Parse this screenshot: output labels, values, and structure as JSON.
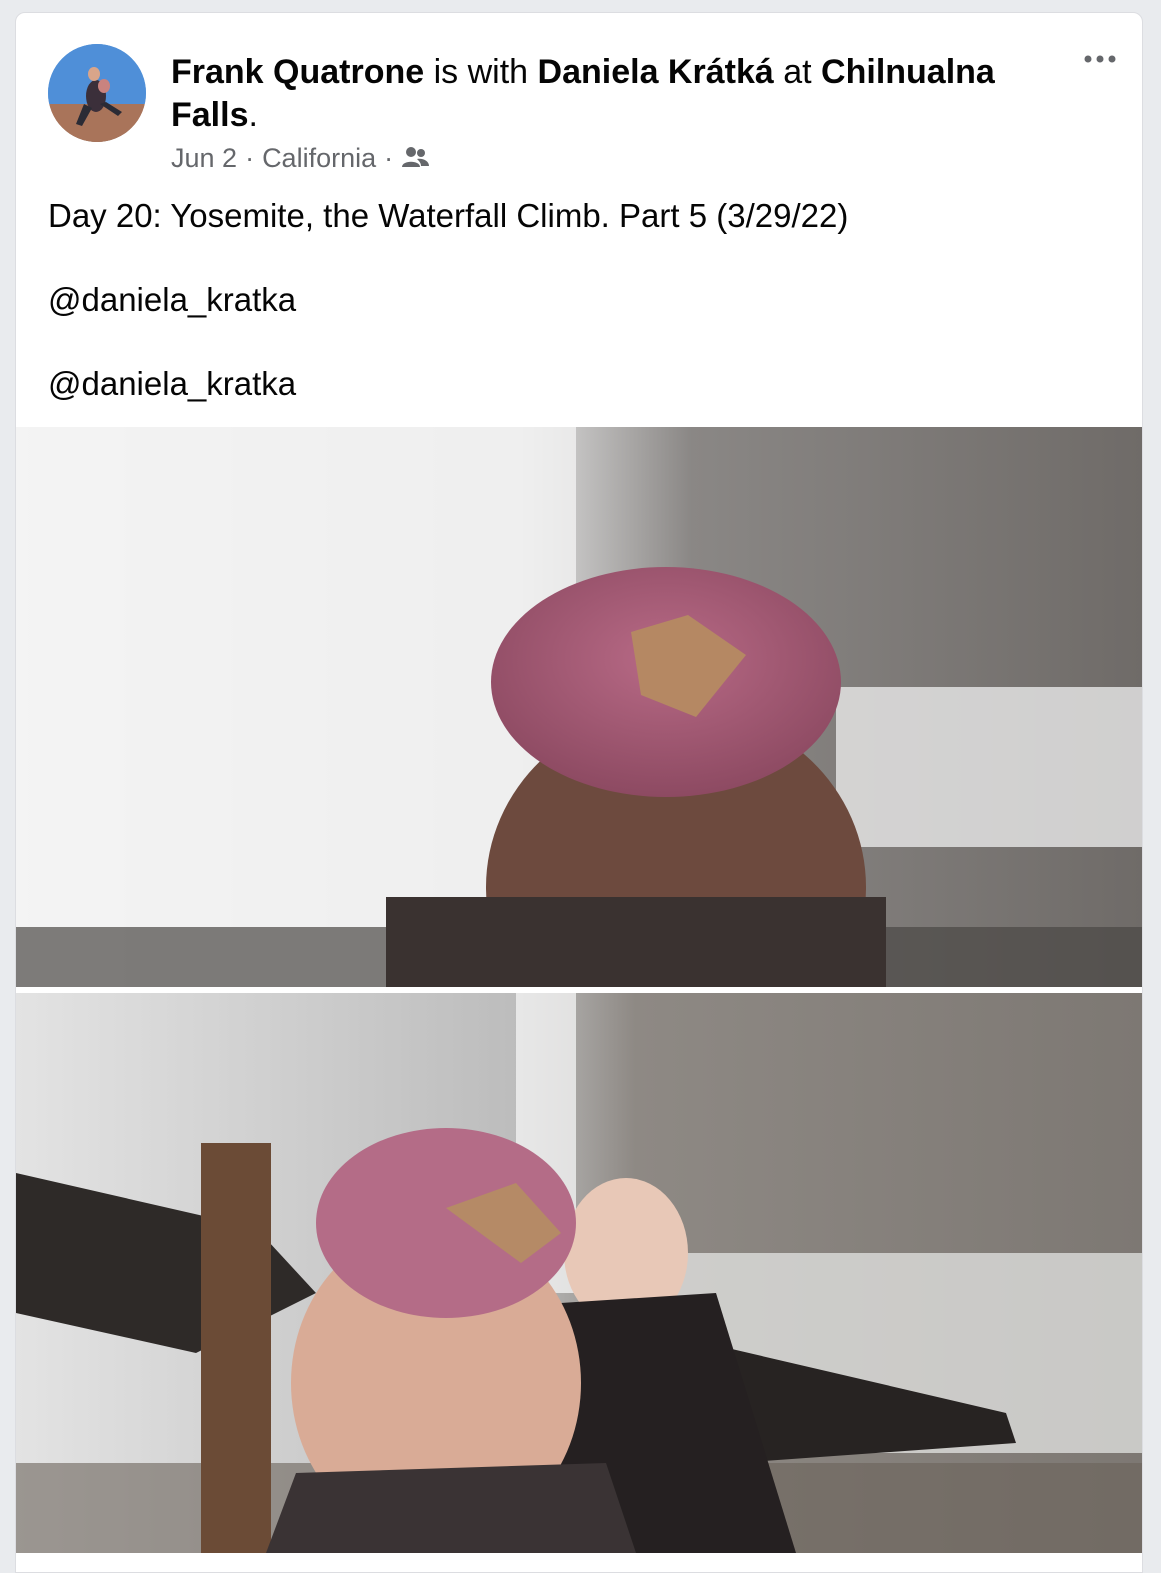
{
  "post": {
    "author": "Frank Quatrone",
    "with_text": "is with",
    "tagged_person": "Daniela Krátká",
    "at_text": "at",
    "location": "Chilnualna Falls",
    "period": ".",
    "date": "Jun 2",
    "separator": "·",
    "place": "California",
    "audience_icon": "friends-icon",
    "more_icon": "more-horizontal-icon",
    "lines": [
      "Day 20: Yosemite, the Waterfall Climb. Part 5 (3/29/22)",
      "@daniela_kratka",
      "@daniela_kratka"
    ]
  },
  "colors": {
    "text_primary": "#050505",
    "text_secondary": "#65676b",
    "card_bg": "#ffffff",
    "page_bg": "#e9ebee"
  }
}
